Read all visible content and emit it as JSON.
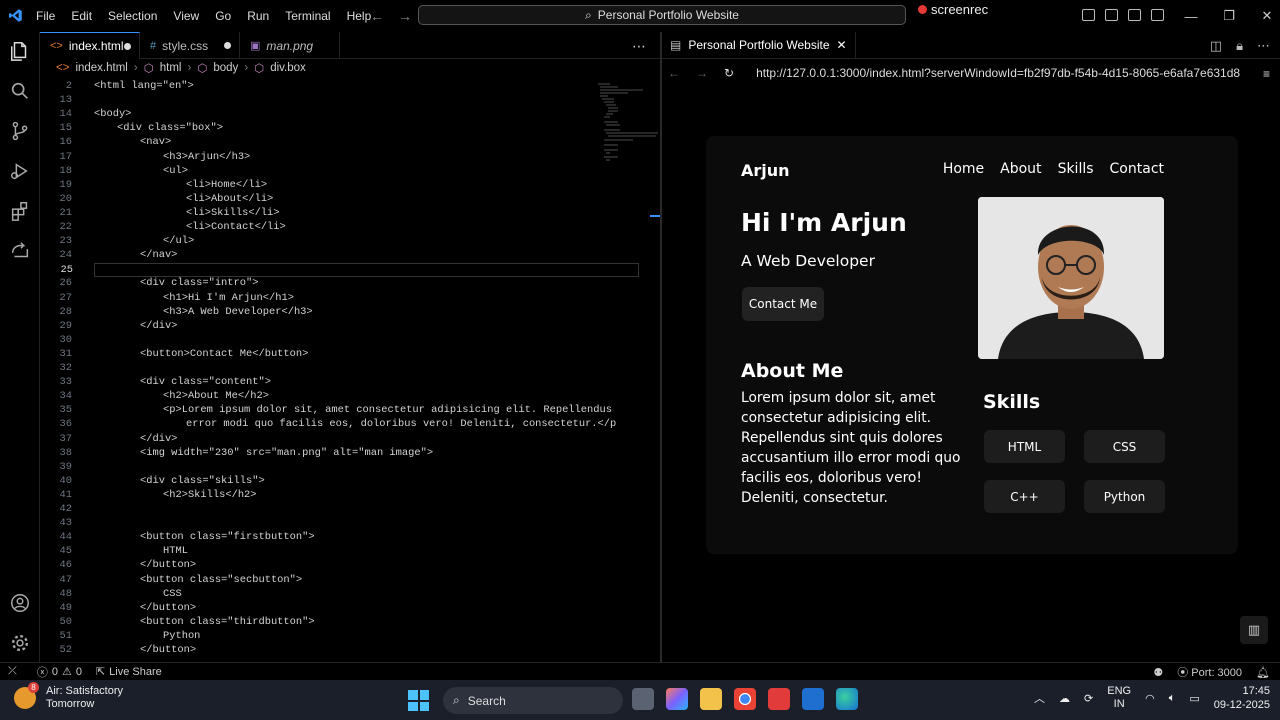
{
  "menu": [
    "File",
    "Edit",
    "Selection",
    "View",
    "Go",
    "Run",
    "Terminal",
    "Help"
  ],
  "command_center": "Personal Portfolio Website",
  "recorder": "screenrec",
  "editor": {
    "tabs": [
      {
        "label": "index.html",
        "modified": true
      },
      {
        "label": "style.css",
        "modified": true
      },
      {
        "label": "man.png",
        "modified": false
      }
    ],
    "breadcrumb": [
      "index.html",
      "html",
      "body",
      "div.box"
    ],
    "lines": [
      {
        "n": "2",
        "t": "<html lang=\"en\">",
        "indent": 0
      },
      {
        "n": "13",
        "t": "",
        "indent": 0
      },
      {
        "n": "14",
        "t": "<body>",
        "indent": 0
      },
      {
        "n": "15",
        "t": "<div class=\"box\">",
        "indent": 1
      },
      {
        "n": "16",
        "t": "<nav>",
        "indent": 2
      },
      {
        "n": "17",
        "t": "<h3>Arjun</h3>",
        "indent": 3
      },
      {
        "n": "18",
        "t": "<ul>",
        "indent": 3
      },
      {
        "n": "19",
        "t": "<li>Home</li>",
        "indent": 4
      },
      {
        "n": "20",
        "t": "<li>About</li>",
        "indent": 4
      },
      {
        "n": "21",
        "t": "<li>Skills</li>",
        "indent": 4
      },
      {
        "n": "22",
        "t": "<li>Contact</li>",
        "indent": 4
      },
      {
        "n": "23",
        "t": "</ul>",
        "indent": 3
      },
      {
        "n": "24",
        "t": "</nav>",
        "indent": 2
      },
      {
        "n": "25",
        "t": "",
        "indent": 0
      },
      {
        "n": "26",
        "t": "<div class=\"intro\">",
        "indent": 2
      },
      {
        "n": "27",
        "t": "<h1>Hi I'm Arjun</h1>",
        "indent": 3
      },
      {
        "n": "28",
        "t": "<h3>A Web Developer</h3>",
        "indent": 3
      },
      {
        "n": "29",
        "t": "</div>",
        "indent": 2
      },
      {
        "n": "30",
        "t": "",
        "indent": 0
      },
      {
        "n": "31",
        "t": "<button>Contact Me</button>",
        "indent": 2
      },
      {
        "n": "32",
        "t": "",
        "indent": 0
      },
      {
        "n": "33",
        "t": "<div class=\"content\">",
        "indent": 2
      },
      {
        "n": "34",
        "t": "<h2>About Me</h2>",
        "indent": 3
      },
      {
        "n": "35",
        "t": "<p>Lorem ipsum dolor sit, amet consectetur adipisicing elit. Repellendus",
        "indent": 3
      },
      {
        "n": "36",
        "t": "error modi quo facilis eos, doloribus vero! Deleniti, consectetur.</p",
        "indent": 4
      },
      {
        "n": "37",
        "t": "</div>",
        "indent": 2
      },
      {
        "n": "38",
        "t": "<img width=\"230\" src=\"man.png\" alt=\"man image\">",
        "indent": 2
      },
      {
        "n": "39",
        "t": "",
        "indent": 0
      },
      {
        "n": "40",
        "t": "<div class=\"skills\">",
        "indent": 2
      },
      {
        "n": "41",
        "t": "<h2>Skills</h2>",
        "indent": 3
      },
      {
        "n": "42",
        "t": "",
        "indent": 0
      },
      {
        "n": "43",
        "t": "",
        "indent": 0
      },
      {
        "n": "44",
        "t": "<button class=\"firstbutton\">",
        "indent": 2
      },
      {
        "n": "45",
        "t": "HTML",
        "indent": 3
      },
      {
        "n": "46",
        "t": "</button>",
        "indent": 2
      },
      {
        "n": "47",
        "t": "<button class=\"secbutton\">",
        "indent": 2
      },
      {
        "n": "48",
        "t": "CSS",
        "indent": 3
      },
      {
        "n": "49",
        "t": "</button>",
        "indent": 2
      },
      {
        "n": "50",
        "t": "<button class=\"thirdbutton\">",
        "indent": 2
      },
      {
        "n": "51",
        "t": "Python",
        "indent": 3
      },
      {
        "n": "52",
        "t": "</button>",
        "indent": 2
      }
    ]
  },
  "browser": {
    "tab_title": "Personal Portfolio Website",
    "url": "http://127.0.0.1:3000/index.html?serverWindowId=fb2f97db-f54b-4d15-8065-e6afa7e631d8",
    "page": {
      "brand": "Arjun",
      "nav": [
        "Home",
        "About",
        "Skills",
        "Contact"
      ],
      "heading": "Hi I'm Arjun",
      "subheading": "A Web Developer",
      "button": "Contact Me",
      "about_title": "About Me",
      "about_text": "Lorem ipsum dolor sit, amet consectetur adipisicing elit. Repellendus sint quis dolores accusantium illo error modi quo facilis eos, doloribus vero! Deleniti, consectetur.",
      "skills_title": "Skills",
      "skills": [
        "HTML",
        "CSS",
        "C++",
        "Python"
      ]
    }
  },
  "status": {
    "errors": "0",
    "warnings": "0",
    "live_share": "Live Share",
    "port": "Port: 3000"
  },
  "taskbar": {
    "weather_title": "Air: Satisfactory",
    "weather_sub": "Tomorrow",
    "weather_badge": "8",
    "search": "Search",
    "lang1": "ENG",
    "lang2": "IN",
    "time": "17:45",
    "date": "09-12-2025"
  },
  "colors": {
    "accent": "#3794ff",
    "keyword": "#569cd6",
    "attr": "#9cdcfe",
    "string": "#ce9178"
  }
}
